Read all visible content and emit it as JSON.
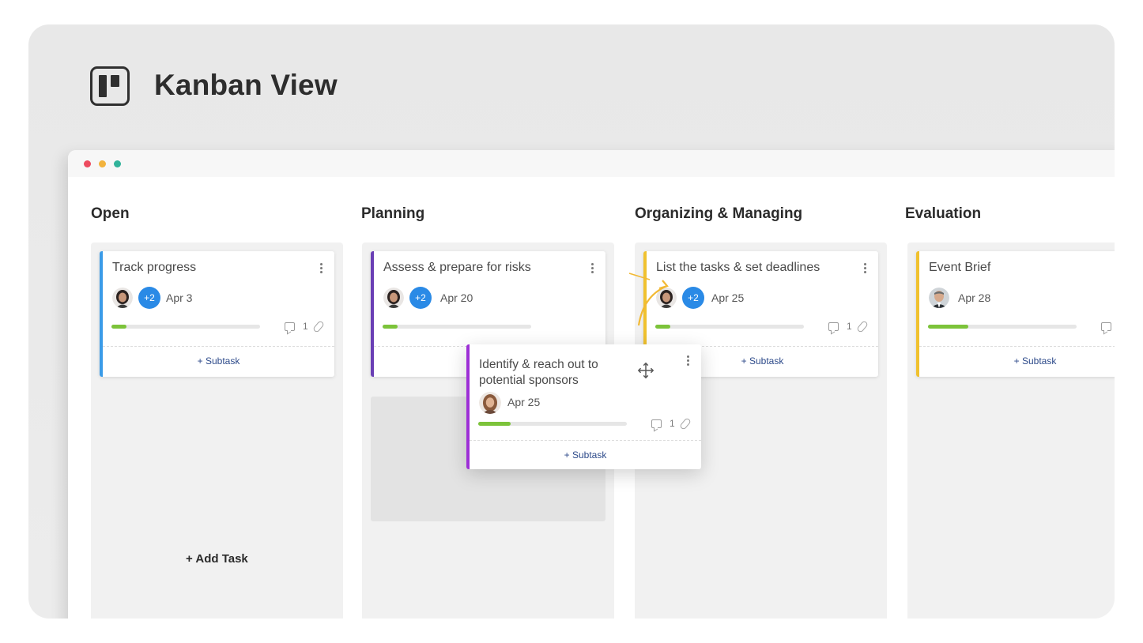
{
  "header": {
    "title": "Kanban View",
    "logo_icon": "kanban-board-icon"
  },
  "window": {
    "controls": [
      "close",
      "minimize",
      "maximize"
    ]
  },
  "columns": [
    {
      "title": "Open",
      "cards": [
        {
          "title": "Track progress",
          "extra_assignees": "+2",
          "due": "Apr 3",
          "progress": 0.1,
          "comments": "1",
          "accent": "#3a9be8",
          "subtask_label": "+ Subtask"
        }
      ],
      "add_task_label": "+ Add Task"
    },
    {
      "title": "Planning",
      "cards": [
        {
          "title": "Assess & prepare for risks",
          "extra_assignees": "+2",
          "due": "Apr 20",
          "progress": 0.1,
          "accent": "#6a3fb5",
          "subtask_label": "+ Subtask"
        }
      ]
    },
    {
      "title": "Organizing & Managing",
      "cards": [
        {
          "title": "List the tasks & set deadlines",
          "extra_assignees": "+2",
          "due": "Apr 25",
          "progress": 0.1,
          "comments": "1",
          "accent": "#f0c12e",
          "subtask_label": "+ Subtask"
        }
      ]
    },
    {
      "title": "Evaluation",
      "cards": [
        {
          "title": "Event Brief",
          "due": "Apr 28",
          "progress": 0.27,
          "accent": "#f0c12e",
          "subtask_label": "+ Subtask"
        }
      ]
    }
  ],
  "dragging_card": {
    "title_line1": "Identify & reach out to",
    "title_line2": "potential sponsors",
    "due": "Apr 25",
    "progress": 0.22,
    "comments": "1",
    "accent": "#9d2fd6",
    "subtask_label": "+ Subtask"
  },
  "colors": {
    "progress_fill": "#7cc33a",
    "badge": "#2a8ae6",
    "drag_arrow": "#f2b933"
  }
}
